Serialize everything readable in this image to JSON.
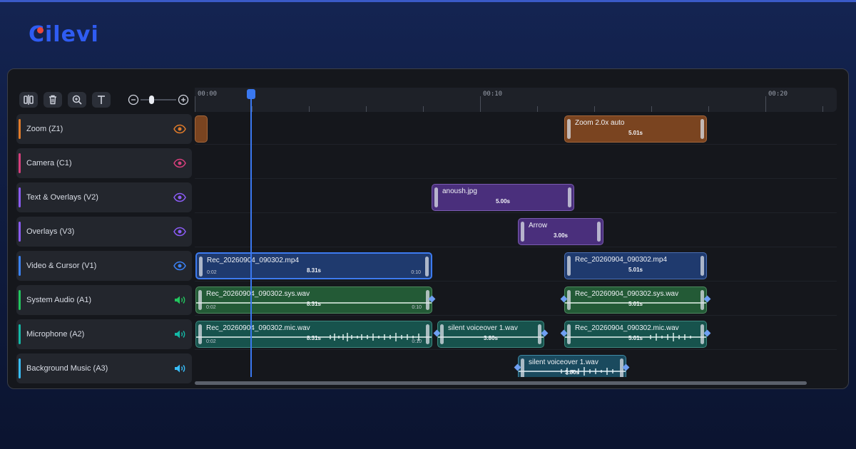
{
  "brand": {
    "name": "Cilevi",
    "accent": "#2f5cf2",
    "dot_color": "#e8473b"
  },
  "toolbar": {
    "buttons": [
      {
        "icon": "split-icon"
      },
      {
        "icon": "trash-icon"
      },
      {
        "icon": "magnify-icon"
      },
      {
        "icon": "text-icon"
      }
    ],
    "zoom_level": 0.3
  },
  "ruler": {
    "labels": [
      "00:00",
      "00:10",
      "00:20"
    ]
  },
  "playhead": {
    "time": "00:02"
  },
  "tracks": [
    {
      "name": "Zoom (Z1)",
      "color": "#e07b2a",
      "icon": "eye-icon"
    },
    {
      "name": "Camera (C1)",
      "color": "#d63f7c",
      "icon": "eye-icon"
    },
    {
      "name": "Text & Overlays (V2)",
      "color": "#8b5cf6",
      "icon": "eye-icon"
    },
    {
      "name": "Overlays (V3)",
      "color": "#8b5cf6",
      "icon": "eye-icon"
    },
    {
      "name": "Video & Cursor (V1)",
      "color": "#3b82f6",
      "icon": "eye-icon"
    },
    {
      "name": "System Audio (A1)",
      "color": "#22c55e",
      "icon": "speaker-icon"
    },
    {
      "name": "Microphone (A2)",
      "color": "#14b8a6",
      "icon": "speaker-icon"
    },
    {
      "name": "Background Music (A3)",
      "color": "#38bdf8",
      "icon": "speaker-icon"
    }
  ],
  "clips": {
    "zoom_a": {
      "title": "",
      "duration": ""
    },
    "zoom_b": {
      "title": "Zoom 2.0x auto",
      "duration": "5.01s"
    },
    "text_a": {
      "title": "anoush.jpg",
      "duration": "5.00s"
    },
    "overlay_a": {
      "title": "Arrow",
      "duration": "3.00s"
    },
    "video_a": {
      "title": "Rec_20260904_090302.mp4",
      "duration": "8.31s",
      "start": "0:02",
      "end": "0:10"
    },
    "video_b": {
      "title": "Rec_20260904_090302.mp4",
      "duration": "5.01s"
    },
    "sys_a": {
      "title": "Rec_20260904_090302.sys.wav",
      "duration": "8.31s",
      "start": "0:02",
      "end": "0:10"
    },
    "sys_b": {
      "title": "Rec_20260904_090302.sys.wav",
      "duration": "5.01s"
    },
    "mic_a": {
      "title": "Rec_20260904_090302.mic.wav",
      "duration": "8.31s",
      "start": "0:02",
      "end": "0:10"
    },
    "mic_b": {
      "title": "silent voiceover 1.wav",
      "duration": "3.80s"
    },
    "mic_c": {
      "title": "Rec_20260904_090302.mic.wav",
      "duration": "5.01s"
    },
    "music_a": {
      "title": "silent voiceover 1.wav",
      "duration": "3.80s"
    }
  }
}
